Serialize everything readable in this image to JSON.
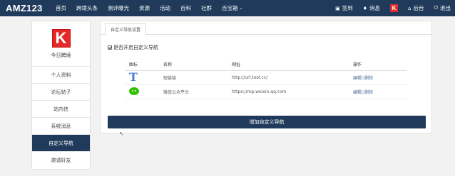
{
  "header": {
    "brand": "AMZ123",
    "nav": [
      "首页",
      "跨境头条",
      "测评曝光",
      "资源",
      "活动",
      "百科",
      "社群",
      "百宝箱"
    ],
    "right": {
      "signin": "签到",
      "messages": "消息",
      "k_badge": "K",
      "backend": "后台",
      "logout": "退出"
    }
  },
  "sidebar": {
    "logo_letter": "K",
    "logo_caption": "今日跨境",
    "items": [
      {
        "label": "个人资料"
      },
      {
        "label": "论坛帖子"
      },
      {
        "label": "站内信"
      },
      {
        "label": "系统消息"
      },
      {
        "label": "自定义导航",
        "active": true
      },
      {
        "label": "邀请好友"
      }
    ]
  },
  "main": {
    "tab": "自定义导航设置",
    "checkbox_label": "是否开启自定义导航",
    "checkbox_checked": true,
    "table": {
      "headers": [
        "图标",
        "名称",
        "网址",
        "操作"
      ],
      "rows": [
        {
          "icon": "T",
          "icon_name": "t-letter-icon",
          "name": "短链接",
          "url": "http://url.tool.cc/",
          "edit": "编辑",
          "delete": "删除"
        },
        {
          "icon_name": "wechat-icon",
          "name": "微信公众平台",
          "url": "https://mp.weixin.qq.com",
          "edit": "编辑",
          "delete": "删除"
        }
      ]
    },
    "add_button": "增加自定义导航"
  },
  "colors": {
    "nav_bg": "#1f3a5b",
    "brand_red": "#e52727",
    "wechat_green": "#2dc100",
    "link_blue": "#4a6b99"
  }
}
